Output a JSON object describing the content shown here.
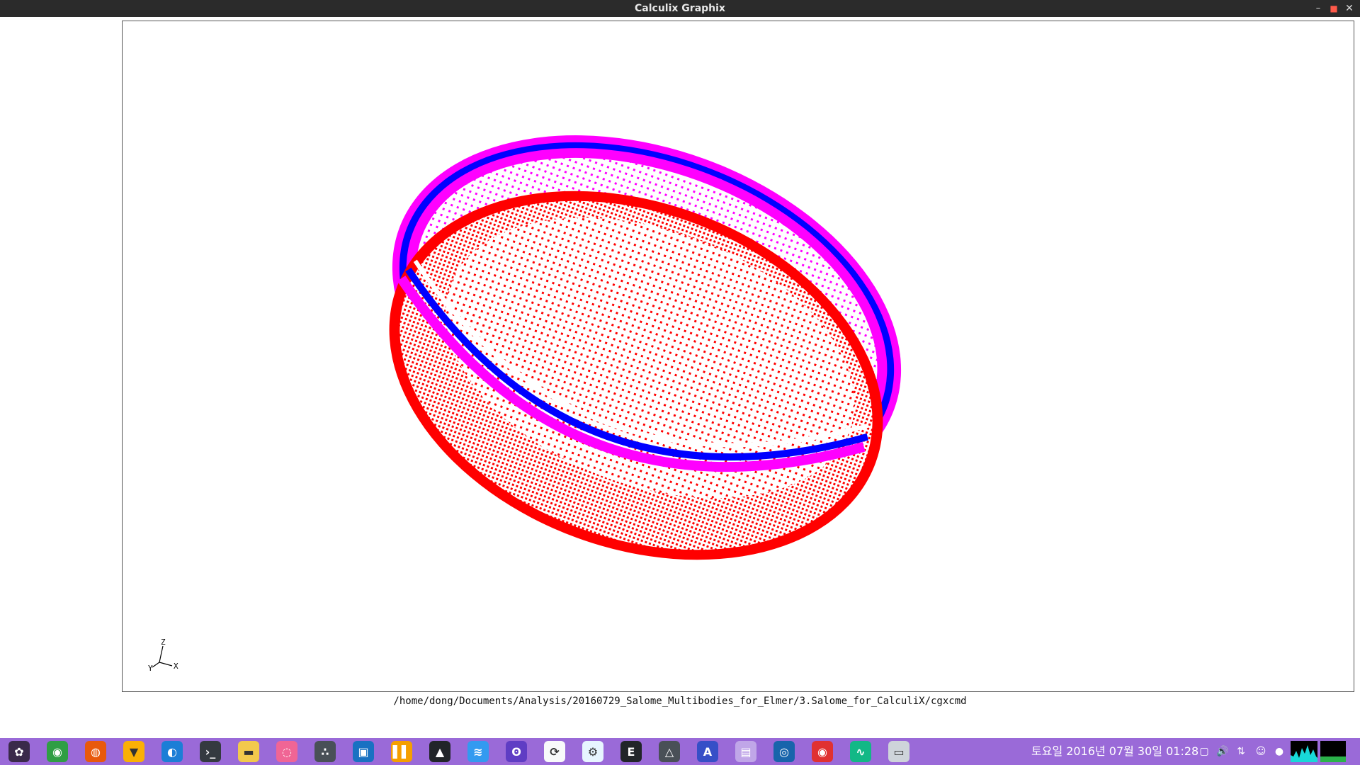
{
  "window": {
    "title": "Calculix Graphix",
    "minimize_label": "–",
    "maximize_label": "■",
    "close_label": "✕"
  },
  "viewport": {
    "axes": {
      "z": "Z",
      "y": "Y",
      "x": "X"
    },
    "colors": {
      "red_body": "#ff0000",
      "magenta_body": "#ff00ff",
      "blue_band": "#0000ff"
    }
  },
  "command_path": "/home/dong/Documents/Analysis/20160729_Salome_Multibodies_for_Elmer/3.Salome_for_CalculiX/cgxcmd",
  "taskbar": {
    "apps": [
      {
        "name": "app-menu-icon",
        "glyph": "✿",
        "bg": "#3a2a4a"
      },
      {
        "name": "chrome-icon",
        "glyph": "◉",
        "bg": "#2f9e44"
      },
      {
        "name": "firefox-icon",
        "glyph": "◍",
        "bg": "#e8590c"
      },
      {
        "name": "brave-icon",
        "glyph": "▼",
        "bg": "#fab005"
      },
      {
        "name": "browser-icon",
        "glyph": "◐",
        "bg": "#1c7ed6"
      },
      {
        "name": "terminal-icon",
        "glyph": "›_",
        "bg": "#343a40"
      },
      {
        "name": "files-icon",
        "glyph": "▬",
        "bg": "#f2c94c"
      },
      {
        "name": "sync-icon",
        "glyph": "◌",
        "bg": "#f06595"
      },
      {
        "name": "dots-app-icon",
        "glyph": "∴",
        "bg": "#495057"
      },
      {
        "name": "blue-app-icon",
        "glyph": "▣",
        "bg": "#1971c2"
      },
      {
        "name": "bars-app-icon",
        "glyph": "▌▌",
        "bg": "#f59f00"
      },
      {
        "name": "gmsh-icon",
        "glyph": "▲",
        "bg": "#212529"
      },
      {
        "name": "salome-icon",
        "glyph": "≋",
        "bg": "#339af0"
      },
      {
        "name": "paraview-icon",
        "glyph": "ʘ",
        "bg": "#5f3dc4"
      },
      {
        "name": "update-icon",
        "glyph": "⟳",
        "bg": "#f8f9fa"
      },
      {
        "name": "settings-icon",
        "glyph": "⚙",
        "bg": "#e7f5ff"
      },
      {
        "name": "elmer-icon",
        "glyph": "E",
        "bg": "#212529"
      },
      {
        "name": "warning-app-icon",
        "glyph": "△",
        "bg": "#495057"
      },
      {
        "name": "text-app-icon",
        "glyph": "A",
        "bg": "#364fc7"
      },
      {
        "name": "document-icon",
        "glyph": "▤",
        "bg": "#c0a6e8"
      },
      {
        "name": "swirl-app-icon",
        "glyph": "◎",
        "bg": "#1864ab"
      },
      {
        "name": "chrome-2-icon",
        "glyph": "◉",
        "bg": "#e03131"
      },
      {
        "name": "monitor-app-icon",
        "glyph": "∿",
        "bg": "#12b886"
      },
      {
        "name": "window-app-icon",
        "glyph": "▭",
        "bg": "#ced4da"
      }
    ],
    "clock": "토요일 2016년 07월 30일 01:28"
  }
}
